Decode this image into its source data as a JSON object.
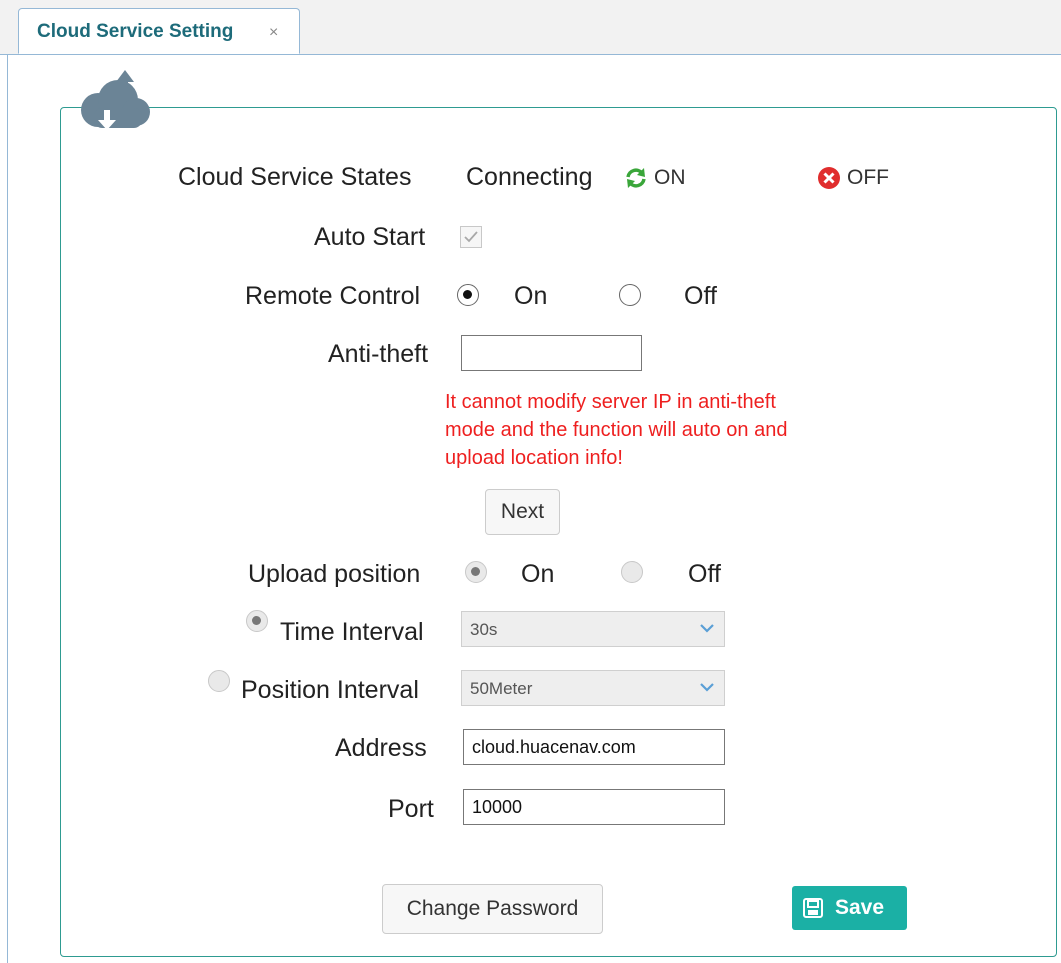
{
  "tab": {
    "title": "Cloud Service Setting",
    "close": "×"
  },
  "states": {
    "label": "Cloud Service States",
    "value": "Connecting",
    "on_label": "ON",
    "off_label": "OFF"
  },
  "auto_start": {
    "label": "Auto Start",
    "checked": true
  },
  "remote_control": {
    "label": "Remote Control",
    "on": "On",
    "off": "Off",
    "selected": "On"
  },
  "anti_theft": {
    "label": "Anti-theft",
    "value": "",
    "warning_lines": [
      "It cannot modify server IP in anti-theft",
      "mode and the function will auto on and",
      "upload location info!"
    ],
    "next_label": "Next"
  },
  "upload_position": {
    "label": "Upload position",
    "on": "On",
    "off": "Off",
    "selected": "On"
  },
  "time_interval": {
    "label": "Time Interval",
    "value": "30s",
    "selected": true
  },
  "position_interval": {
    "label": "Position Interval",
    "value": "50Meter",
    "selected": false
  },
  "address": {
    "label": "Address",
    "value": "cloud.huacenav.com"
  },
  "port": {
    "label": "Port",
    "value": "10000"
  },
  "buttons": {
    "change_password": "Change Password",
    "save": "Save"
  },
  "colors": {
    "accent": "#1bb0a5",
    "warning": "#ee1f1f",
    "on_icon": "#3aa63a",
    "off_icon": "#e02d2d",
    "tab_text": "#1d6b7a"
  }
}
